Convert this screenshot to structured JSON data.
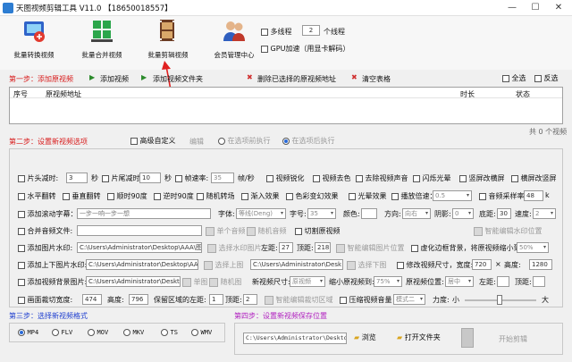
{
  "title": "天图视频剪辑工具 V11.0 【18650018557】",
  "window": {
    "min": "—",
    "max": "☐",
    "close": "✕"
  },
  "toolbar": {
    "b1": "批量转换视频",
    "b2": "批量合并视频",
    "b3": "批量剪辑视频",
    "b4": "会员管理中心"
  },
  "options": {
    "multithread": "多线程",
    "threads": "2",
    "threads_unit": "个线程",
    "gpu": "GPU加速（用显卡解码）"
  },
  "step1": {
    "title": "第一步：添加原视频",
    "add_video": "添加视频",
    "add_folder": "添加视频文件夹",
    "delete_selected": "删除已选择的原视频地址",
    "clear": "清空表格",
    "select_all": "全选",
    "invert": "反选"
  },
  "table": {
    "c1": "序号",
    "c2": "原视频地址",
    "c3": "时长",
    "c4": "状态"
  },
  "count": "共 0 个视频",
  "step2": {
    "title": "第二步：设置新视频选项",
    "advanced": "高级自定义",
    "edit": "编辑",
    "before": "在选项前执行",
    "after": "在选项后执行"
  },
  "r1": {
    "head_cut": "片头减时:",
    "head_val": "3",
    "sec": "秒",
    "tail_cut": "片尾减时:",
    "tail_val": "10",
    "fps": "帧速率:",
    "fps_val": "35",
    "fps_unit": "帧/秒",
    "sharpen": "视频锐化",
    "decolor": "视频去色",
    "remove_audio": "去除视频声音",
    "flash": "闪烁光晕",
    "v_blur": "竖屏改横屏",
    "h_blur": "横屏改竖屏"
  },
  "r2": {
    "hflip": "水平翻转",
    "vflip": "垂直翻转",
    "cw90": "顺时90度",
    "ccw90": "逆时90度",
    "random": "随机转场",
    "fade": "渐入效果",
    "color_change": "色彩变幻效果",
    "light": "光晕效果",
    "speed": "播放倍速：",
    "speed_val": "0.5",
    "audio_rate": "音频采样率：",
    "audio_val": "48",
    "audio_unit": "k"
  },
  "r3": {
    "scroll": "添加滚动字幕：",
    "scroll_val": "一步一响一步一想",
    "font": "字体:",
    "font_val": "等线(Deng)",
    "size": "字号:",
    "size_val": "35",
    "color": "颜色:",
    "dir": "方向:",
    "dir_val": "向右",
    "shadow": "阴影:",
    "shadow_val": "0",
    "bottom": "底距:",
    "bottom_val": "30",
    "speed": "速度:",
    "speed_val": "2"
  },
  "r4": {
    "merge_audio": "合并音频文件:",
    "single": "单个音频",
    "random": "随机音频",
    "slice": "切割原视频",
    "smart": "智能编辑水印位置"
  },
  "r5": {
    "watermark": "添加图片水印:",
    "path": "C:\\Users\\Administrator\\Desktop\\AAA\\图",
    "sel_pos": "选择水印图片",
    "left": "左距:",
    "left_val": "27",
    "top": "顶距:",
    "top_val": "218",
    "smart": "智能编辑图片位置",
    "blur_bg": "虚化边框背景，将原视频缩小到:",
    "blur_val": "50%"
  },
  "r6": {
    "add_image": "添加上下图片水印:",
    "path1": "C:\\Users\\Administrator\\Desktop\\AA",
    "sel_up": "选择上图",
    "path2": "C:\\Users\\Administrator\\Desk",
    "sel_down": "选择下图",
    "resize": "修改视频尺寸，宽度:",
    "w": "720",
    "x": "×",
    "h_label": "高度:",
    "h": "1280"
  },
  "r7": {
    "bg_image": "添加视频背景图片:",
    "path": "C:\\Users\\Administrator\\Desktop\\A",
    "single": "单图",
    "random": "随机图",
    "new_size": "新视频尺寸:",
    "new_size_val": "原视频",
    "shrink": "缩小原视频到:",
    "shrink_val": "75%",
    "pos": "原视频位置:",
    "pos_val": "居中",
    "left": "左距:",
    "top": "顶距:"
  },
  "r8": {
    "crop": "画面裁切宽度:",
    "crop_val": "474",
    "height": "高度:",
    "height_val": "796",
    "keep_left": "保留区域的左距:",
    "left_val": "1",
    "top": "顶距:",
    "top_val": "2",
    "smart": "智能编辑裁切区域",
    "compress": "压缩视频音量",
    "mode": "模式二",
    "strength": "力度:",
    "small": "小",
    "big": "大"
  },
  "step3": {
    "title": "第三步：选择新视频格式",
    "formats": [
      "MP4",
      "FLV",
      "MOV",
      "MKV",
      "TS",
      "WMV"
    ]
  },
  "step4": {
    "title": "第四步：设置新视频保存位置",
    "path": "C:\\Users\\Administrator\\Desktop",
    "browse": "浏览",
    "open_folder": "打开文件夹",
    "start": "开始剪辑"
  },
  "colors": {
    "red": "#d81b1b",
    "blue": "#1f3fcf",
    "purple": "#b01fbf"
  }
}
